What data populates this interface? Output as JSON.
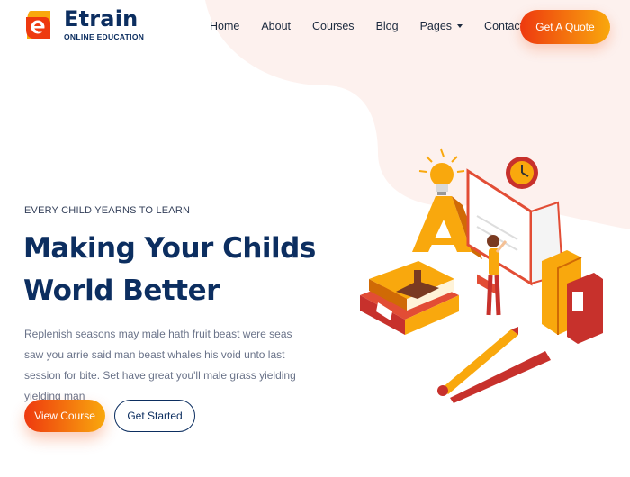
{
  "brand": {
    "name": "Etrain",
    "tagline": "ONLINE EDUCATION",
    "logo_icon": "etrain-logo-icon"
  },
  "nav": {
    "items": [
      {
        "label": "Home"
      },
      {
        "label": "About"
      },
      {
        "label": "Courses"
      },
      {
        "label": "Blog"
      },
      {
        "label": "Pages",
        "has_dropdown": true
      },
      {
        "label": "Contact"
      }
    ],
    "cta_label": "Get A Quote"
  },
  "hero": {
    "eyebrow": "EVERY CHILD YEARNS TO LEARN",
    "headline_line1": "Making Your Childs",
    "headline_line2": "World Better",
    "body": "Replenish seasons may male hath fruit beast were seas saw you arrie said man beast whales his void unto last session for bite. Set have great you'll male grass yielding yielding man",
    "primary_button": "View Course",
    "secondary_button": "Get Started"
  },
  "colors": {
    "navy": "#0c2e60",
    "orange_start": "#ee390f",
    "orange_end": "#f9a80d",
    "blob": "#fdf1ee"
  }
}
